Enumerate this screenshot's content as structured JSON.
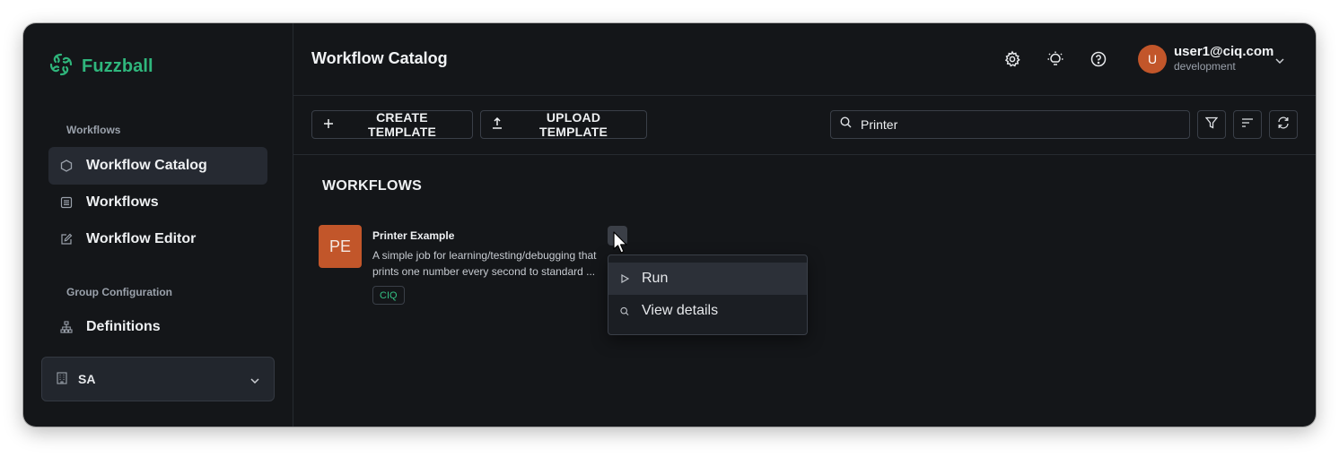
{
  "app": {
    "name": "Fuzzball",
    "brand_color": "#2fb67c",
    "logo_icon": "fuzzball-swirl-icon"
  },
  "sidebar": {
    "sections": [
      {
        "label": "Workflows"
      },
      {
        "label": "Group Configuration"
      }
    ],
    "items": [
      {
        "label": "Workflow Catalog",
        "icon": "hexagon-icon",
        "active": true
      },
      {
        "label": "Workflows",
        "icon": "list-icon"
      },
      {
        "label": "Workflow Editor",
        "icon": "edit-icon"
      },
      {
        "label": "Definitions",
        "icon": "hierarchy-icon"
      }
    ],
    "org_select": {
      "value": "SA",
      "icon": "building-icon"
    }
  },
  "header": {
    "title": "Workflow Catalog",
    "icons": [
      "settings-icon",
      "lightbulb-icon",
      "help-icon"
    ],
    "user": {
      "avatar_letter": "U",
      "email": "user1@ciq.com",
      "environment": "development",
      "avatar_color": "#c2562a"
    }
  },
  "toolbar": {
    "create_label": "CREATE TEMPLATE",
    "upload_label": "UPLOAD TEMPLATE",
    "search_value": "Printer",
    "icons": [
      "filter-icon",
      "sort-icon",
      "refresh-icon"
    ]
  },
  "main": {
    "section_title": "WORKFLOWS",
    "cards": [
      {
        "initials": "PE",
        "title": "Printer Example",
        "description_line1": "A simple job for learning/testing/debugging that",
        "description_line2": "prints one number every second to standard ...",
        "tag": "CIQ"
      }
    ]
  },
  "context_menu": {
    "items": [
      {
        "label": "Run",
        "icon": "play-icon"
      },
      {
        "label": "View details",
        "icon": "search-icon"
      }
    ]
  }
}
